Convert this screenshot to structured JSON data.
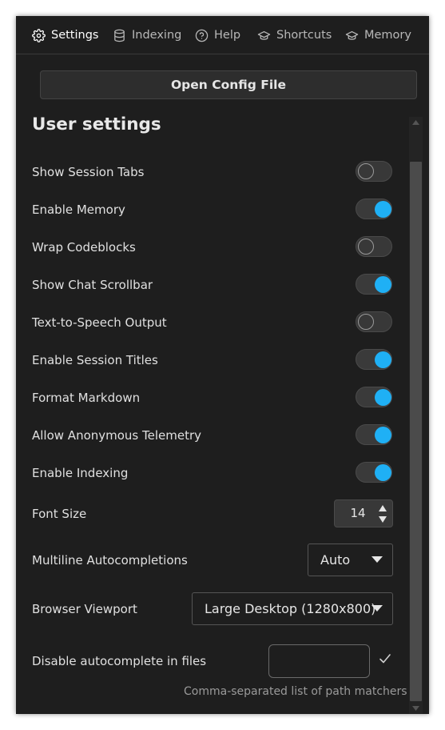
{
  "nav": {
    "items": [
      {
        "label": "Settings",
        "icon": "gear-icon",
        "active": true
      },
      {
        "label": "Indexing",
        "icon": "database-icon",
        "active": false
      },
      {
        "label": "Help",
        "icon": "help-circle-icon",
        "active": false
      },
      {
        "label": "Shortcuts",
        "icon": "graduation-cap-icon",
        "active": false
      },
      {
        "label": "Memory",
        "icon": "graduation-cap-icon",
        "active": false
      }
    ]
  },
  "config_button": {
    "label": "Open Config File"
  },
  "section": {
    "title": "User settings"
  },
  "toggles": [
    {
      "label": "Show Session Tabs",
      "on": false
    },
    {
      "label": "Enable Memory",
      "on": true
    },
    {
      "label": "Wrap Codeblocks",
      "on": false
    },
    {
      "label": "Show Chat Scrollbar",
      "on": true
    },
    {
      "label": "Text-to-Speech Output",
      "on": false
    },
    {
      "label": "Enable Session Titles",
      "on": true
    },
    {
      "label": "Format Markdown",
      "on": true
    },
    {
      "label": "Allow Anonymous Telemetry",
      "on": true
    },
    {
      "label": "Enable Indexing",
      "on": true
    }
  ],
  "font_size": {
    "label": "Font Size",
    "value": "14"
  },
  "multiline": {
    "label": "Multiline Autocompletions",
    "value": "Auto"
  },
  "viewport": {
    "label": "Browser Viewport",
    "value": "Large Desktop (1280x800)"
  },
  "autocomplete": {
    "label": "Disable autocomplete in files",
    "value": "",
    "hint": "Comma-separated list of path matchers"
  },
  "colors": {
    "background": "#1e1e1e",
    "accent": "#1fb0f5",
    "text": "#e0e0e0",
    "muted": "#9a9a9a",
    "nav_active": "#ffffff",
    "nav_inactive": "#b8b8b8"
  }
}
